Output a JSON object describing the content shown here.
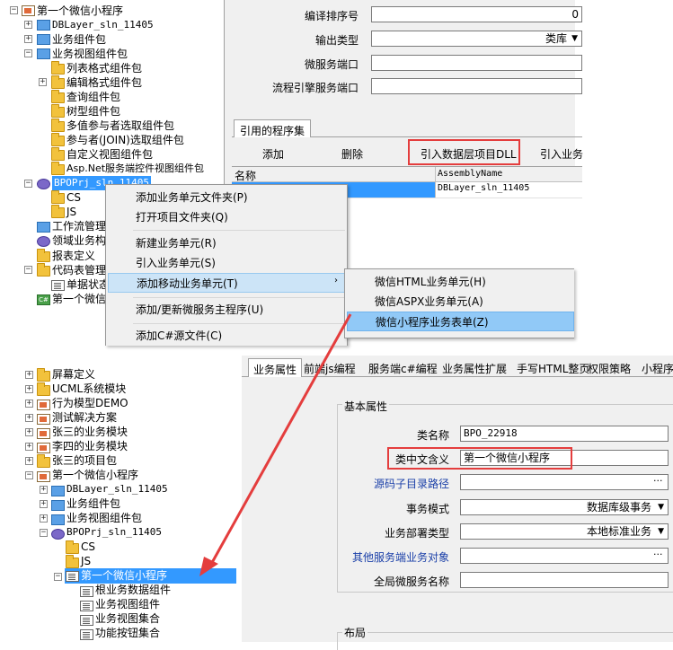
{
  "top_tree": {
    "root_label": "第一个微信小程序",
    "items": [
      {
        "label": "DBLayer_sln_11405"
      },
      {
        "label": "业务组件包"
      },
      {
        "label": "业务视图组件包"
      },
      {
        "label": "列表格式组件包"
      },
      {
        "label": "编辑格式组件包"
      },
      {
        "label": "查询组件包"
      },
      {
        "label": "树型组件包"
      },
      {
        "label": "多值参与者选取组件包"
      },
      {
        "label": "参与者(JOIN)选取组件包"
      },
      {
        "label": "自定义视图组件包"
      },
      {
        "label": "Asp.Net服务端控件视图组件包"
      },
      {
        "label": "BPOPrj_sln_11405"
      },
      {
        "label": "CS"
      },
      {
        "label": "JS"
      },
      {
        "label": "工作流管理"
      },
      {
        "label": "领域业务构"
      },
      {
        "label": "报表定义"
      },
      {
        "label": "代码表管理"
      },
      {
        "label": "单据状态"
      },
      {
        "label": "第一个微信"
      }
    ]
  },
  "top_props": {
    "rows": [
      {
        "label": "编译排序号",
        "value": "0"
      },
      {
        "label": "输出类型",
        "value": "类库"
      },
      {
        "label": "微服务端口",
        "value": ""
      },
      {
        "label": "流程引擎服务端口",
        "value": ""
      }
    ]
  },
  "ref_tab": "引用的程序集",
  "ref_toolbar": {
    "add": "添加",
    "delete": "删除",
    "import_dll": "引入数据层项目DLL",
    "import_biz": "引入业务"
  },
  "ref_grid": {
    "col_name": "名称",
    "col_assembly": "AssemblyName",
    "row_assembly": "DBLayer_sln_11405"
  },
  "context_menu": {
    "items": [
      "添加业务单元文件夹(P)",
      "打开项目文件夹(Q)",
      "新建业务单元(R)",
      "引入业务单元(S)",
      "添加移动业务单元(T)",
      "添加/更新微服务主程序(U)",
      "添加C#源文件(C)"
    ]
  },
  "submenu": {
    "items": [
      "微信HTML业务单元(H)",
      "微信ASPX业务单元(A)",
      "微信小程序业务表单(Z)"
    ]
  },
  "bottom_tree": {
    "items": [
      {
        "label": "屏幕定义"
      },
      {
        "label": "UCML系统模块"
      },
      {
        "label": "行为模型DEMO"
      },
      {
        "label": "测试解决方案"
      },
      {
        "label": "张三的业务模块"
      },
      {
        "label": "李四的业务模块"
      },
      {
        "label": "张三的项目包"
      },
      {
        "label": "第一个微信小程序"
      },
      {
        "label": "DBLayer_sln_11405"
      },
      {
        "label": "业务组件包"
      },
      {
        "label": "业务视图组件包"
      },
      {
        "label": "BPOPrj_sln_11405"
      },
      {
        "label": "CS"
      },
      {
        "label": "JS"
      },
      {
        "label": "第一个微信小程序"
      },
      {
        "label": "根业务数据组件"
      },
      {
        "label": "业务视图组件"
      },
      {
        "label": "业务视图集合"
      },
      {
        "label": "功能按钮集合"
      }
    ]
  },
  "bottom_tabs": [
    "业务属性",
    "前端js编程",
    "服务端c#编程",
    "业务属性扩展",
    "手写HTML整页",
    "权限策略",
    "小程序"
  ],
  "basic_props": {
    "group_title": "基本属性",
    "rows": [
      {
        "label": "类名称",
        "value": "BPO_22918"
      },
      {
        "label": "类中文含义",
        "value": "第一个微信小程序"
      },
      {
        "label": "源码子目录路径",
        "value": ""
      },
      {
        "label": "事务模式",
        "value": "数据库级事务"
      },
      {
        "label": "业务部署类型",
        "value": "本地标准业务"
      },
      {
        "label": "其他服务端业务对象",
        "value": ""
      },
      {
        "label": "全局微服务名称",
        "value": ""
      }
    ],
    "layout_group_title": "布局"
  },
  "colors": {
    "highlight": "#e43d3d",
    "selection": "#3399ff",
    "link_blue": "#1a3fa8"
  }
}
